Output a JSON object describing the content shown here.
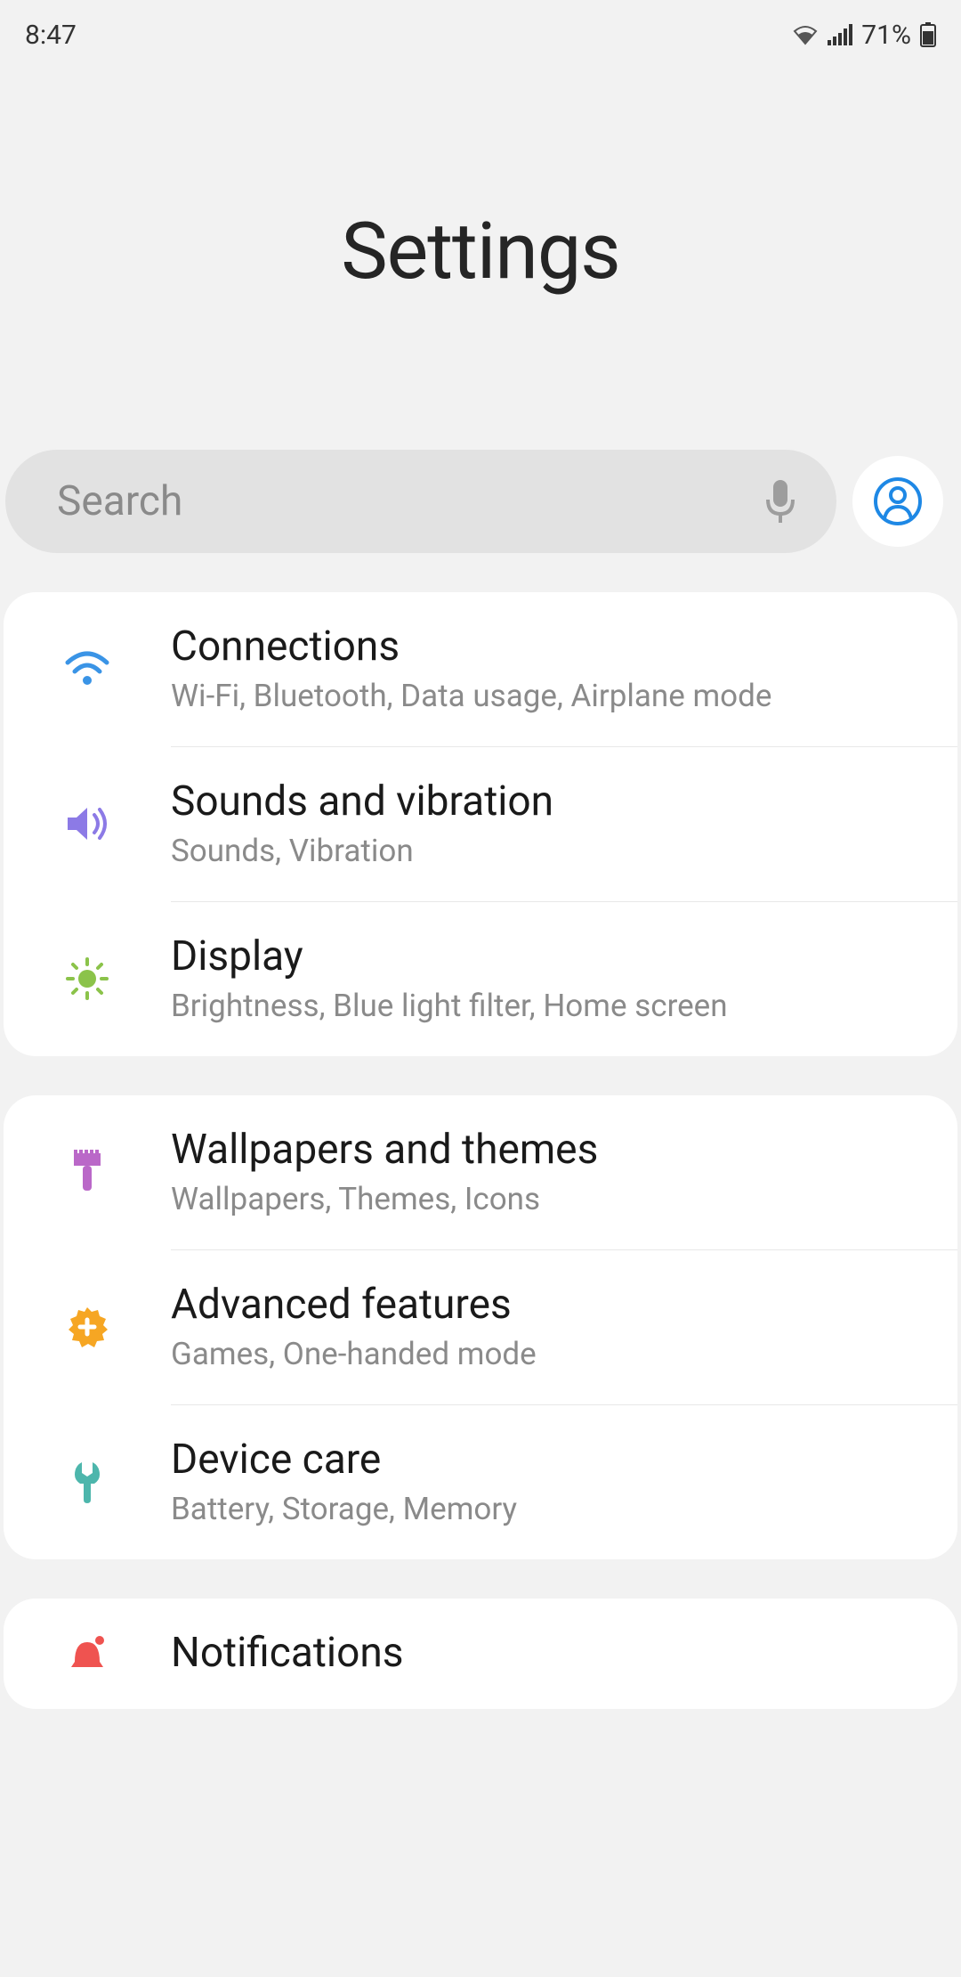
{
  "statusbar": {
    "time": "8:47",
    "battery_percent": "71%"
  },
  "hero": {
    "title": "Settings"
  },
  "search": {
    "placeholder": "Search"
  },
  "groups": [
    {
      "items": [
        {
          "key": "connections",
          "title": "Connections",
          "subtitle": "Wi-Fi, Bluetooth, Data usage, Airplane mode",
          "icon": "wifi-icon",
          "color": "#3a94e6"
        },
        {
          "key": "sounds",
          "title": "Sounds and vibration",
          "subtitle": "Sounds, Vibration",
          "icon": "speaker-icon",
          "color": "#8c7ae6"
        },
        {
          "key": "display",
          "title": "Display",
          "subtitle": "Brightness, Blue light filter, Home screen",
          "icon": "brightness-icon",
          "color": "#8bc34a"
        }
      ]
    },
    {
      "items": [
        {
          "key": "wallpapers",
          "title": "Wallpapers and themes",
          "subtitle": "Wallpapers, Themes, Icons",
          "icon": "brush-icon",
          "color": "#ba68c8"
        },
        {
          "key": "advanced",
          "title": "Advanced features",
          "subtitle": "Games, One-handed mode",
          "icon": "plus-gear-icon",
          "color": "#f6a623"
        },
        {
          "key": "devicecare",
          "title": "Device care",
          "subtitle": "Battery, Storage, Memory",
          "icon": "wrench-icon",
          "color": "#4db6ac"
        }
      ]
    },
    {
      "items": [
        {
          "key": "notifications",
          "title": "Notifications",
          "subtitle": "",
          "icon": "bell-icon",
          "color": "#ef5350"
        }
      ]
    }
  ]
}
